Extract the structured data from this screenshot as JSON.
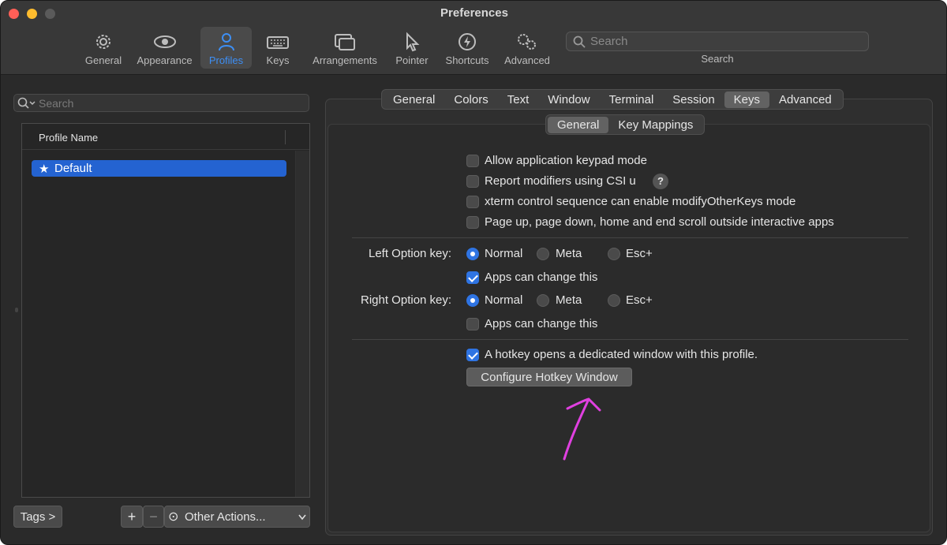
{
  "window": {
    "title": "Preferences",
    "traffic_colors": [
      "#ff5f57",
      "#febc2e",
      "#5a5a5a"
    ]
  },
  "toolbar": {
    "items": [
      {
        "label": "General",
        "icon": "gear-icon"
      },
      {
        "label": "Appearance",
        "icon": "eye-icon"
      },
      {
        "label": "Profiles",
        "icon": "person-icon",
        "active": true
      },
      {
        "label": "Keys",
        "icon": "keyboard-icon"
      },
      {
        "label": "Arrangements",
        "icon": "windows-icon"
      },
      {
        "label": "Pointer",
        "icon": "pointer-icon"
      },
      {
        "label": "Shortcuts",
        "icon": "lightning-icon"
      },
      {
        "label": "Advanced",
        "icon": "gears-icon"
      }
    ],
    "search_placeholder": "Search",
    "search_label": "Search"
  },
  "sidebar": {
    "search_placeholder": "Search",
    "column_header": "Profile Name",
    "profiles": [
      {
        "name": "Default",
        "default": true
      }
    ],
    "tags_label": "Tags >",
    "add_label": "+",
    "remove_label": "−",
    "other_actions_label": "Other Actions...",
    "other_actions_icon": "⊙"
  },
  "tabs": {
    "main": [
      "General",
      "Colors",
      "Text",
      "Window",
      "Terminal",
      "Session",
      "Keys",
      "Advanced"
    ],
    "main_selected": "Keys",
    "sub": [
      "General",
      "Key Mappings"
    ],
    "sub_selected": "General"
  },
  "keys_general": {
    "options": [
      {
        "label": "Allow application keypad mode",
        "checked": false
      },
      {
        "label": "Report modifiers using CSI u",
        "checked": false,
        "help": "?"
      },
      {
        "label": "xterm control sequence can enable modifyOtherKeys mode",
        "checked": false
      },
      {
        "label": "Page up, page down, home and end scroll outside interactive apps",
        "checked": false
      }
    ],
    "left_option": {
      "label": "Left Option key:",
      "choices": [
        "Normal",
        "Meta",
        "Esc+"
      ],
      "selected": "Normal",
      "apps_can_change_label": "Apps can change this",
      "apps_can_change": true
    },
    "right_option": {
      "label": "Right Option key:",
      "choices": [
        "Normal",
        "Meta",
        "Esc+"
      ],
      "selected": "Normal",
      "apps_can_change_label": "Apps can change this",
      "apps_can_change": false
    },
    "hotkey": {
      "label": "A hotkey opens a dedicated window with this profile.",
      "checked": true,
      "button_label": "Configure Hotkey Window"
    },
    "annotation_color": "#e040e0"
  }
}
